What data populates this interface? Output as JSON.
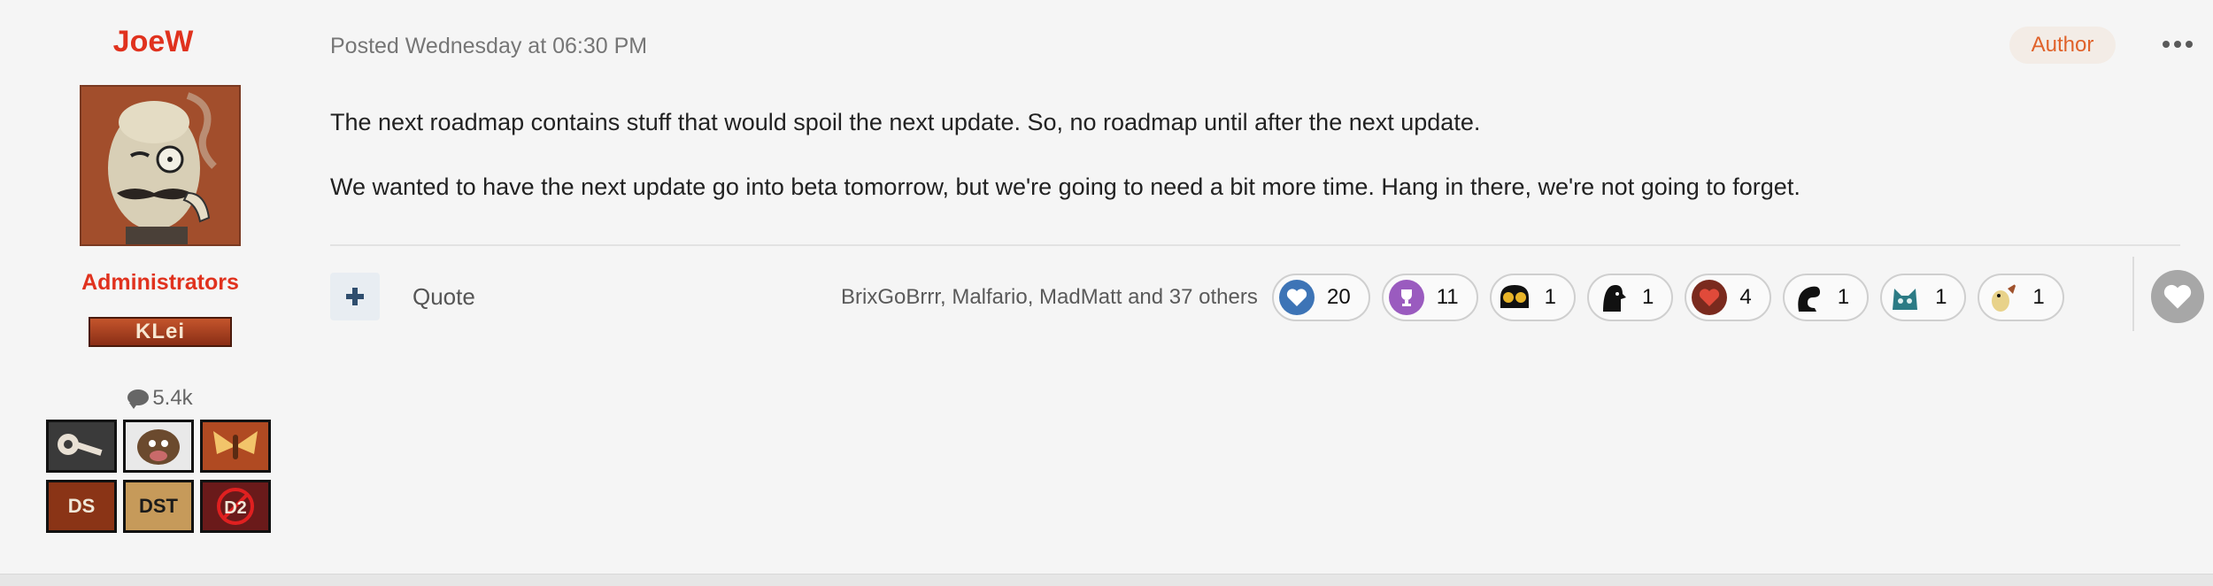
{
  "author": {
    "name": "JoeW",
    "role": "Administrators",
    "group_badge": "KLei",
    "post_count": "5.4k",
    "badges": [
      {
        "icon": "bone-key-icon",
        "bg": "#3a3a3a"
      },
      {
        "icon": "beefalo-icon",
        "bg": "#e9e9e9"
      },
      {
        "icon": "moth-icon",
        "bg": "#b04a22"
      },
      {
        "icon": "ds-logo-icon",
        "text": "DS",
        "bg": "#8a3416"
      },
      {
        "icon": "dst-logo-icon",
        "text": "DST",
        "bg": "#c69a5a"
      },
      {
        "icon": "d2-logo-icon",
        "text": "D2",
        "bg": "#6a1a1a"
      }
    ]
  },
  "post": {
    "posted": "Posted Wednesday at 06:30 PM",
    "author_tag": "Author",
    "paragraphs": [
      "The next roadmap contains stuff that would spoil the next update. So, no roadmap until after the next update.",
      "We wanted to have the next update go into beta tomorrow, but we're going to need a bit more time. Hang in there, we're not going to forget."
    ]
  },
  "footer": {
    "quote_label": "Quote",
    "reacted_by": "BrixGoBrrr, Malfario, MadMatt and 37 others",
    "reactions": [
      {
        "icon": "heart-icon",
        "count": "20",
        "color": "#3d74b6"
      },
      {
        "icon": "trophy-icon",
        "count": "11",
        "color": "#9a5bbf"
      },
      {
        "icon": "goggles-icon",
        "count": "1",
        "color": "#e8b428"
      },
      {
        "icon": "shadow-hood-icon",
        "count": "1",
        "color": "#111111"
      },
      {
        "icon": "red-heart-icon",
        "count": "4",
        "color": "#7a2a1e"
      },
      {
        "icon": "tentacle-icon",
        "count": "1",
        "color": "#111111"
      },
      {
        "icon": "cat-icon",
        "count": "1",
        "color": "#3fa0a6"
      },
      {
        "icon": "bird-icon",
        "count": "1",
        "color": "#e0c060"
      }
    ]
  }
}
